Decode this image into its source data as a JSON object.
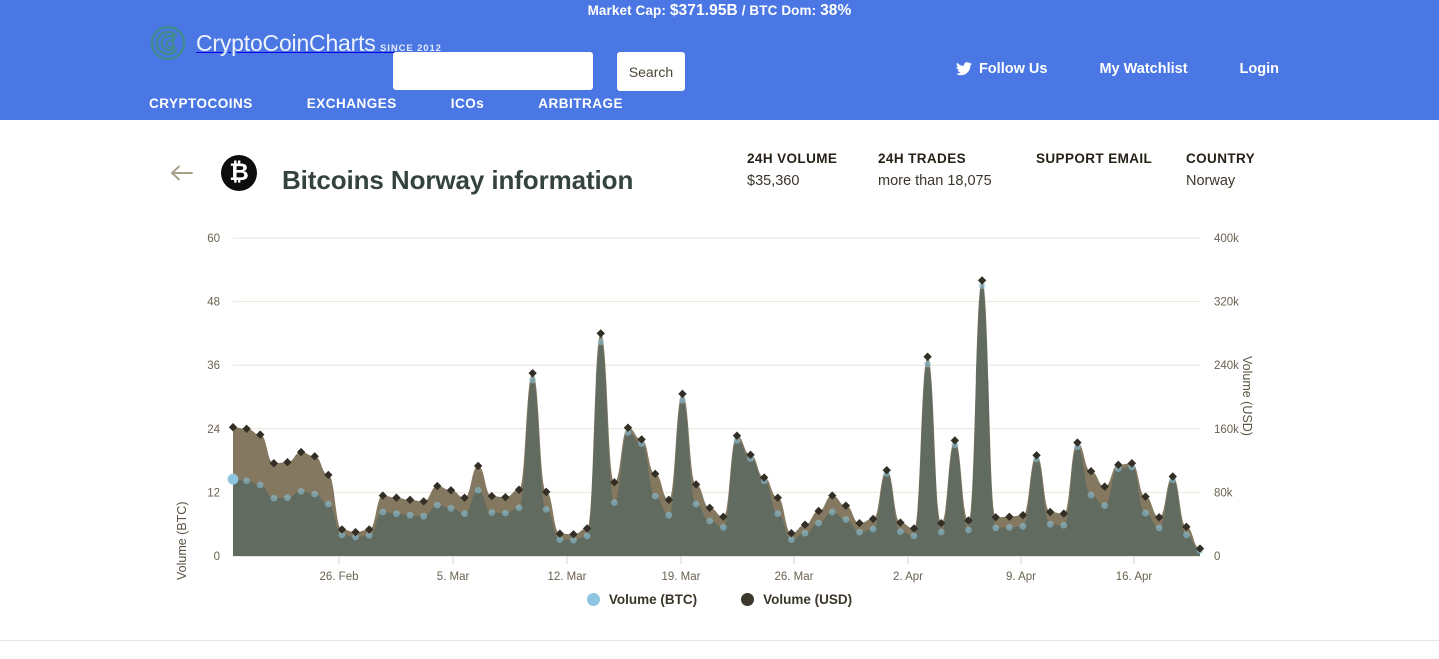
{
  "ticker": {
    "market_cap_label": "Market Cap:",
    "market_cap_value": "$371.95B",
    "separator": "/",
    "btc_dom_label": "BTC Dom:",
    "btc_dom_value": "38%"
  },
  "brand": {
    "name": "CryptoCoinCharts",
    "tagline": "SINCE 2012",
    "logo_color": "#3f8a8c"
  },
  "search": {
    "value": "",
    "placeholder": "",
    "button_label": "Search"
  },
  "header_links": [
    {
      "label": "Follow Us",
      "icon": "twitter-icon"
    },
    {
      "label": "My Watchlist",
      "icon": ""
    },
    {
      "label": "Login",
      "icon": ""
    }
  ],
  "nav": [
    {
      "label": "CRYPTOCOINS"
    },
    {
      "label": "EXCHANGES"
    },
    {
      "label": "ICOs"
    },
    {
      "label": "ARBITRAGE"
    }
  ],
  "title_row": {
    "back_icon": "arrow-left-icon",
    "coin_icon": "bitcoin-icon",
    "coin_glyph": "₿",
    "title": "Bitcoins Norway information"
  },
  "stats": [
    {
      "label": "24H VOLUME",
      "value": "$35,360"
    },
    {
      "label": "24H TRADES",
      "value": "more than 18,075"
    },
    {
      "label": "SUPPORT EMAIL",
      "value": ""
    },
    {
      "label": "COUNTRY",
      "value": "Norway"
    }
  ],
  "colors": {
    "header_blue": "#4a77e3",
    "btc_series": "#7d7157",
    "usd_series": "#5e6a60",
    "marker": "#332f26",
    "btc_legend_dot": "#8cc6e0",
    "usd_legend_dot": "#3c372b",
    "grid": "#e9e6d8"
  },
  "chart_data": {
    "type": "area",
    "title": "",
    "xlabel": "",
    "ylabel": "Volume (BTC)",
    "y2label": "Volume (USD)",
    "ylim": [
      0,
      60
    ],
    "yticks": [
      "0",
      "12",
      "24",
      "36",
      "48",
      "60"
    ],
    "ytick_values": [
      0,
      12,
      24,
      36,
      48,
      60
    ],
    "y2lim": [
      0,
      400000
    ],
    "y2ticks": [
      "0",
      "80k",
      "160k",
      "240k",
      "320k",
      "400k"
    ],
    "y2tick_values": [
      0,
      80000,
      160000,
      240000,
      320000,
      400000
    ],
    "grid": true,
    "legend_position": "bottom",
    "xticks": [
      "26. Feb",
      "5. Mar",
      "12. Mar",
      "19. Mar",
      "26. Mar",
      "2. Apr",
      "9. Apr",
      "16. Apr"
    ],
    "xtick_positions": [
      339,
      453,
      567,
      681,
      794,
      908,
      1021,
      1134
    ],
    "series": [
      {
        "name": "Volume (BTC)",
        "color": "#8cc6e0",
        "marker": "circle",
        "values": [
          14.5,
          14.2,
          13.4,
          10.9,
          11.0,
          12.2,
          11.7,
          9.8,
          4.0,
          3.6,
          3.9,
          8.3,
          8.0,
          7.7,
          7.5,
          9.6,
          9.0,
          8.0,
          12.4,
          8.2,
          8.1,
          9.1,
          33.2,
          8.8,
          3.1,
          3.0,
          3.8,
          40.4,
          10.1,
          23.3,
          21.2,
          11.3,
          7.7,
          29.4,
          9.8,
          6.6,
          5.4,
          21.8,
          18.4,
          14.2,
          8.0,
          3.1,
          4.3,
          6.2,
          8.3,
          6.9,
          4.5,
          5.1,
          15.6,
          4.6,
          3.8,
          36.2,
          4.5,
          21.0,
          4.9,
          51.0,
          5.3,
          5.4,
          5.6,
          18.3,
          6.0,
          5.8,
          20.6,
          11.5,
          9.5,
          16.5,
          16.8,
          8.1,
          5.3,
          14.4,
          4.0,
          1.0
        ]
      },
      {
        "name": "Volume (USD)",
        "color": "#5e6a60",
        "marker": "diamond",
        "values_btc_scale": [
          24.3,
          24.0,
          22.9,
          17.5,
          17.7,
          19.6,
          18.8,
          15.3,
          5.0,
          4.5,
          5.0,
          11.4,
          11.0,
          10.6,
          10.3,
          13.2,
          12.4,
          11.0,
          17.0,
          11.3,
          11.1,
          12.5,
          34.5,
          12.1,
          4.2,
          4.1,
          5.2,
          42.0,
          13.9,
          24.2,
          22.0,
          15.5,
          10.6,
          30.6,
          13.5,
          9.1,
          7.4,
          22.7,
          19.1,
          14.8,
          11.0,
          4.3,
          5.9,
          8.5,
          11.4,
          9.5,
          6.2,
          7.0,
          16.2,
          6.3,
          5.2,
          37.6,
          6.2,
          21.8,
          6.7,
          52.0,
          7.3,
          7.4,
          7.7,
          19.0,
          8.3,
          8.0,
          21.4,
          16.0,
          13.1,
          17.2,
          17.5,
          11.2,
          7.3,
          15.0,
          5.5,
          1.4
        ]
      }
    ]
  },
  "legend": [
    {
      "label": "Volume (BTC)",
      "color": "#8cc6e0"
    },
    {
      "label": "Volume (USD)",
      "color": "#3c372b"
    }
  ]
}
